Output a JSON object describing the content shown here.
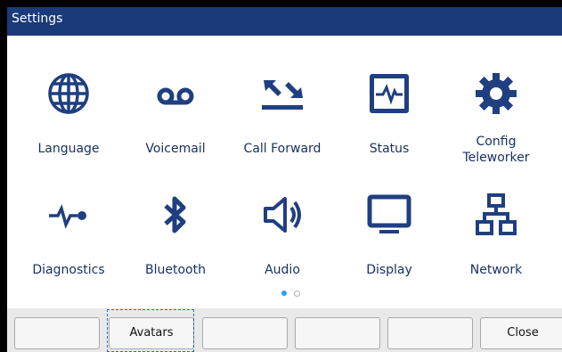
{
  "window": {
    "title": "Settings"
  },
  "tiles": [
    {
      "label": "Language",
      "icon": "globe-icon"
    },
    {
      "label": "Voicemail",
      "icon": "voicemail-icon"
    },
    {
      "label": "Call Forward",
      "icon": "call-forward-icon"
    },
    {
      "label": "Status",
      "icon": "status-icon"
    },
    {
      "label": "Config\nTeleworker",
      "icon": "gear-icon"
    },
    {
      "label": "Diagnostics",
      "icon": "diagnostics-icon"
    },
    {
      "label": "Bluetooth",
      "icon": "bluetooth-icon"
    },
    {
      "label": "Audio",
      "icon": "speaker-icon"
    },
    {
      "label": "Display",
      "icon": "monitor-icon"
    },
    {
      "label": "Network",
      "icon": "network-icon"
    }
  ],
  "pager": {
    "current_page": 1,
    "total_pages": 2
  },
  "softkeys": [
    "",
    "Avatars",
    "",
    "",
    "",
    "Close"
  ],
  "colors": {
    "titlebar": "#1a3a7a",
    "icon": "#1f3f80",
    "pager_active": "#2a9df4"
  }
}
